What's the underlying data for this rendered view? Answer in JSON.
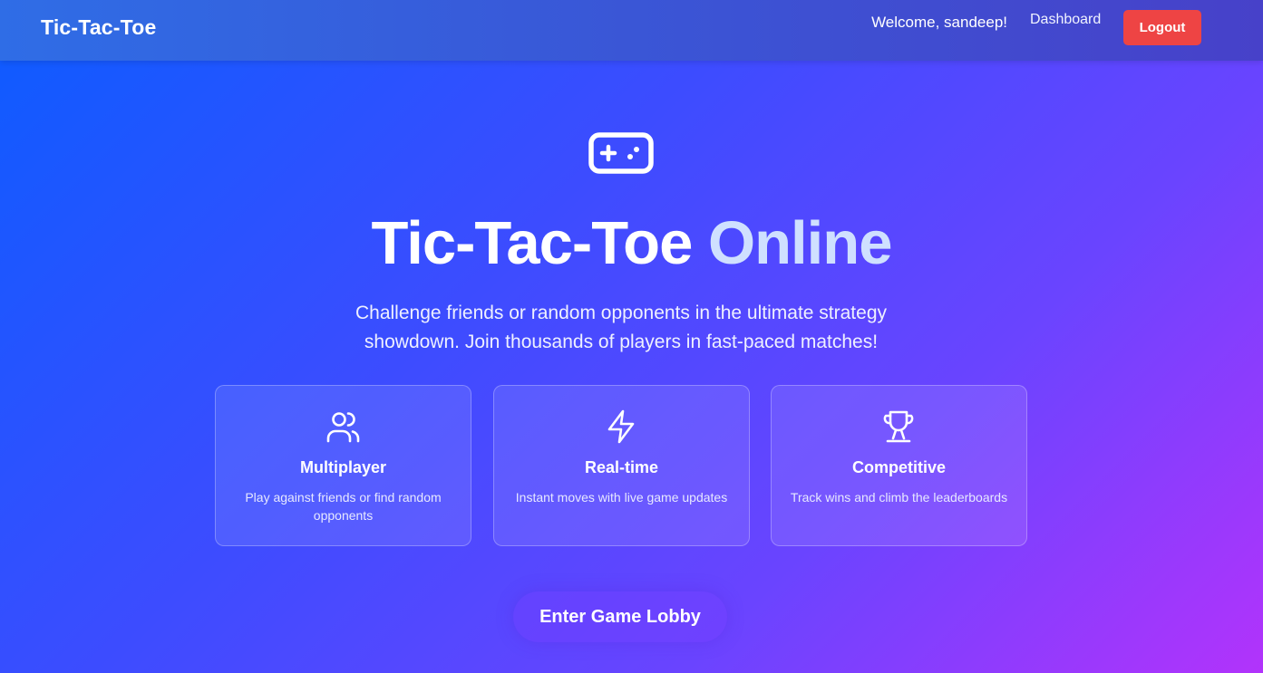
{
  "navbar": {
    "brand": "Tic-Tac-Toe",
    "welcome": "Welcome, sandeep!",
    "dashboard_label": "Dashboard",
    "logout_label": "Logout"
  },
  "hero": {
    "icon": "gamepad-icon",
    "title_part1": "Tic-Tac-Toe",
    "title_part2": "Online",
    "subtitle": "Challenge friends or random opponents in the ultimate strategy showdown. Join thousands of players in fast-paced matches!"
  },
  "features": [
    {
      "icon": "users-icon",
      "title": "Multiplayer",
      "description": "Play against friends or find random opponents"
    },
    {
      "icon": "lightning-icon",
      "title": "Real-time",
      "description": "Instant moves with live game updates"
    },
    {
      "icon": "trophy-icon",
      "title": "Competitive",
      "description": "Track wins and climb the leaderboards"
    }
  ],
  "cta": {
    "label": "Enter Game Lobby"
  },
  "colors": {
    "logout": "#ee4444",
    "title_accent": "#cfe0ff",
    "gradient_start": "#0d5cff",
    "gradient_end": "#b233fb"
  }
}
